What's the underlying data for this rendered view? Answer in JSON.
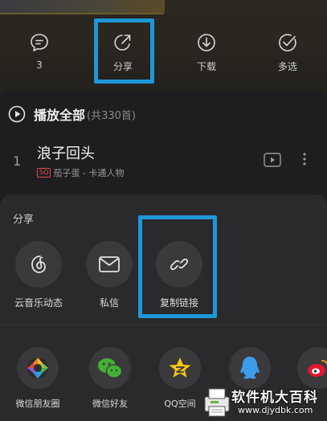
{
  "actions": [
    {
      "label": "3",
      "icon": "comment-icon"
    },
    {
      "label": "分享",
      "icon": "share-icon"
    },
    {
      "label": "下载",
      "icon": "download-icon"
    },
    {
      "label": "多选",
      "icon": "multi-select-icon"
    }
  ],
  "highlight_color": "#1e97d8",
  "playlist": {
    "play_all_label": "播放全部",
    "count_label": "(共330首)"
  },
  "songs": [
    {
      "index": "1",
      "title": "浪子回头",
      "quality_badge": "SQ",
      "artist_album": "茄子蛋 - 卡通人物"
    }
  ],
  "share_sheet": {
    "title": "分享",
    "primary": [
      {
        "label": "云音乐动态",
        "icon": "cloud-music-feed-icon"
      },
      {
        "label": "私信",
        "icon": "mail-icon"
      },
      {
        "label": "复制链接",
        "icon": "link-icon"
      }
    ],
    "apps": [
      {
        "label": "微信朋友圈",
        "icon": "wechat-moments-icon"
      },
      {
        "label": "微信好友",
        "icon": "wechat-icon"
      },
      {
        "label": "QQ空间",
        "icon": "qzone-icon"
      },
      {
        "label": "",
        "icon": "qq-icon"
      },
      {
        "label": "",
        "icon": "weibo-icon"
      }
    ]
  },
  "watermark": {
    "text": "软件机大百科",
    "url": "www.djydbk.com"
  }
}
